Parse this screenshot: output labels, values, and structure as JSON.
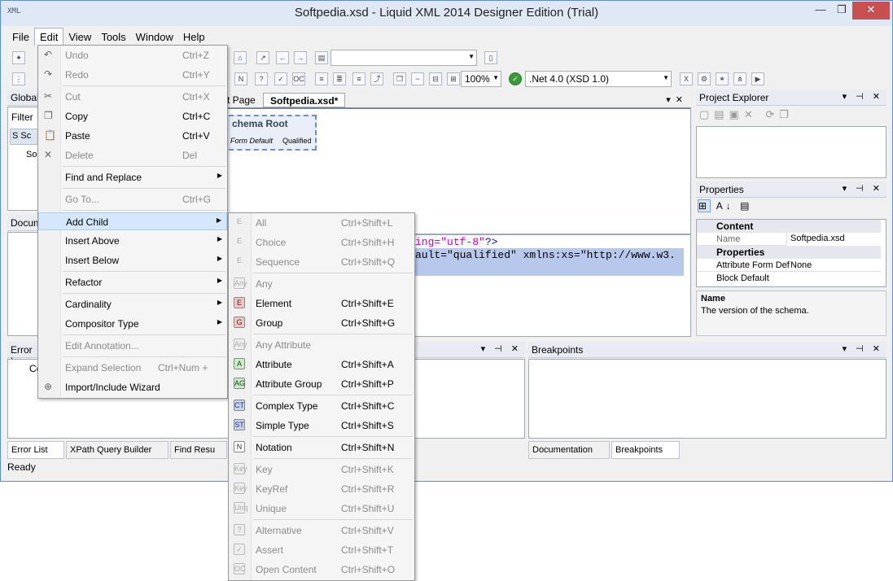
{
  "window": {
    "title": "Softpedia.xsd - Liquid XML 2014 Designer Edition (Trial)",
    "app_icon": "XML"
  },
  "menubar": [
    "File",
    "Edit",
    "View",
    "Tools",
    "Window",
    "Help"
  ],
  "toolbar": {
    "zoom": "100%",
    "framework": ".Net 4.0 (XSD 1.0)"
  },
  "left_panels": {
    "global_title": "Global",
    "filter_label": "Filter",
    "document_title": "Docum",
    "error_title": "Error L"
  },
  "editor": {
    "tabs": [
      "t Page",
      "Softpedia.xsd*"
    ],
    "schema_root": "chema Root",
    "form_default": "Form Default",
    "qualified": "Qualified",
    "code_line1a": "ing=",
    "code_line1b": "\"utf-8\"",
    "code_line1c": "?>",
    "code_line2": "ault=\"qualified\" xmlns:xs=\"http://www.w3."
  },
  "project_explorer": {
    "title": "Project Explorer"
  },
  "properties": {
    "title": "Properties",
    "section_content": "Content",
    "name_label": "Name",
    "name_value": "Softpedia.xsd",
    "section_properties": "Properties",
    "attr_form_label": "Attribute Form Def",
    "attr_form_value": "None",
    "block_default_label": "Block Default",
    "desc_title": "Name",
    "desc_text": "The version of the schema."
  },
  "breakpoints": {
    "title": "Breakpoints"
  },
  "bottom_tabs": [
    "Error List",
    "XPath Query Builder",
    "Find Resu"
  ],
  "right_bottom_tabs": [
    "Documentation",
    "Breakpoints"
  ],
  "status": "Ready",
  "edit_menu": [
    {
      "label": "Undo",
      "shortcut": "Ctrl+Z",
      "disabled": true
    },
    {
      "label": "Redo",
      "shortcut": "Ctrl+Y",
      "disabled": true
    },
    {
      "label": "Cut",
      "shortcut": "Ctrl+X",
      "disabled": true
    },
    {
      "label": "Copy",
      "shortcut": "Ctrl+C",
      "disabled": false
    },
    {
      "label": "Paste",
      "shortcut": "Ctrl+V",
      "disabled": false
    },
    {
      "label": "Delete",
      "shortcut": "Del",
      "disabled": true
    },
    {
      "label": "Find and Replace",
      "shortcut": "",
      "disabled": false
    },
    {
      "label": "Go To...",
      "shortcut": "Ctrl+G",
      "disabled": true
    },
    {
      "label": "Add Child",
      "shortcut": "",
      "disabled": false
    },
    {
      "label": "Insert Above",
      "shortcut": "",
      "disabled": false
    },
    {
      "label": "Insert Below",
      "shortcut": "",
      "disabled": false
    },
    {
      "label": "Refactor",
      "shortcut": "",
      "disabled": false
    },
    {
      "label": "Cardinality",
      "shortcut": "",
      "disabled": false
    },
    {
      "label": "Compositor Type",
      "shortcut": "",
      "disabled": false
    },
    {
      "label": "Edit Annotation...",
      "shortcut": "",
      "disabled": true
    },
    {
      "label": "Expand Selection",
      "shortcut": "Ctrl+Num +",
      "disabled": true
    },
    {
      "label": "Import/Include Wizard",
      "shortcut": "",
      "disabled": false
    }
  ],
  "add_child_menu": [
    {
      "label": "All",
      "shortcut": "Ctrl+Shift+L",
      "disabled": true,
      "icon": "E"
    },
    {
      "label": "Choice",
      "shortcut": "Ctrl+Shift+H",
      "disabled": true,
      "icon": "E"
    },
    {
      "label": "Sequence",
      "shortcut": "Ctrl+Shift+Q",
      "disabled": true,
      "icon": "E"
    },
    {
      "label": "Any",
      "shortcut": "",
      "disabled": true,
      "icon": "Any"
    },
    {
      "label": "Element",
      "shortcut": "Ctrl+Shift+E",
      "disabled": false,
      "icon": "E"
    },
    {
      "label": "Group",
      "shortcut": "Ctrl+Shift+G",
      "disabled": false,
      "icon": "G"
    },
    {
      "label": "Any Attribute",
      "shortcut": "",
      "disabled": true,
      "icon": "Any"
    },
    {
      "label": "Attribute",
      "shortcut": "Ctrl+Shift+A",
      "disabled": false,
      "icon": "A"
    },
    {
      "label": "Attribute Group",
      "shortcut": "Ctrl+Shift+P",
      "disabled": false,
      "icon": "AG"
    },
    {
      "label": "Complex Type",
      "shortcut": "Ctrl+Shift+C",
      "disabled": false,
      "icon": "CT"
    },
    {
      "label": "Simple Type",
      "shortcut": "Ctrl+Shift+S",
      "disabled": false,
      "icon": "ST"
    },
    {
      "label": "Notation",
      "shortcut": "Ctrl+Shift+N",
      "disabled": false,
      "icon": "N"
    },
    {
      "label": "Key",
      "shortcut": "Ctrl+Shift+K",
      "disabled": true,
      "icon": "Key"
    },
    {
      "label": "KeyRef",
      "shortcut": "Ctrl+Shift+R",
      "disabled": true,
      "icon": "Key"
    },
    {
      "label": "Unique",
      "shortcut": "Ctrl+Shift+U",
      "disabled": true,
      "icon": "Unq"
    },
    {
      "label": "Alternative",
      "shortcut": "Ctrl+Shift+V",
      "disabled": true,
      "icon": "?"
    },
    {
      "label": "Assert",
      "shortcut": "Ctrl+Shift+T",
      "disabled": true,
      "icon": "✓"
    },
    {
      "label": "Open Content",
      "shortcut": "Ctrl+Shift+O",
      "disabled": true,
      "icon": "OC"
    }
  ]
}
